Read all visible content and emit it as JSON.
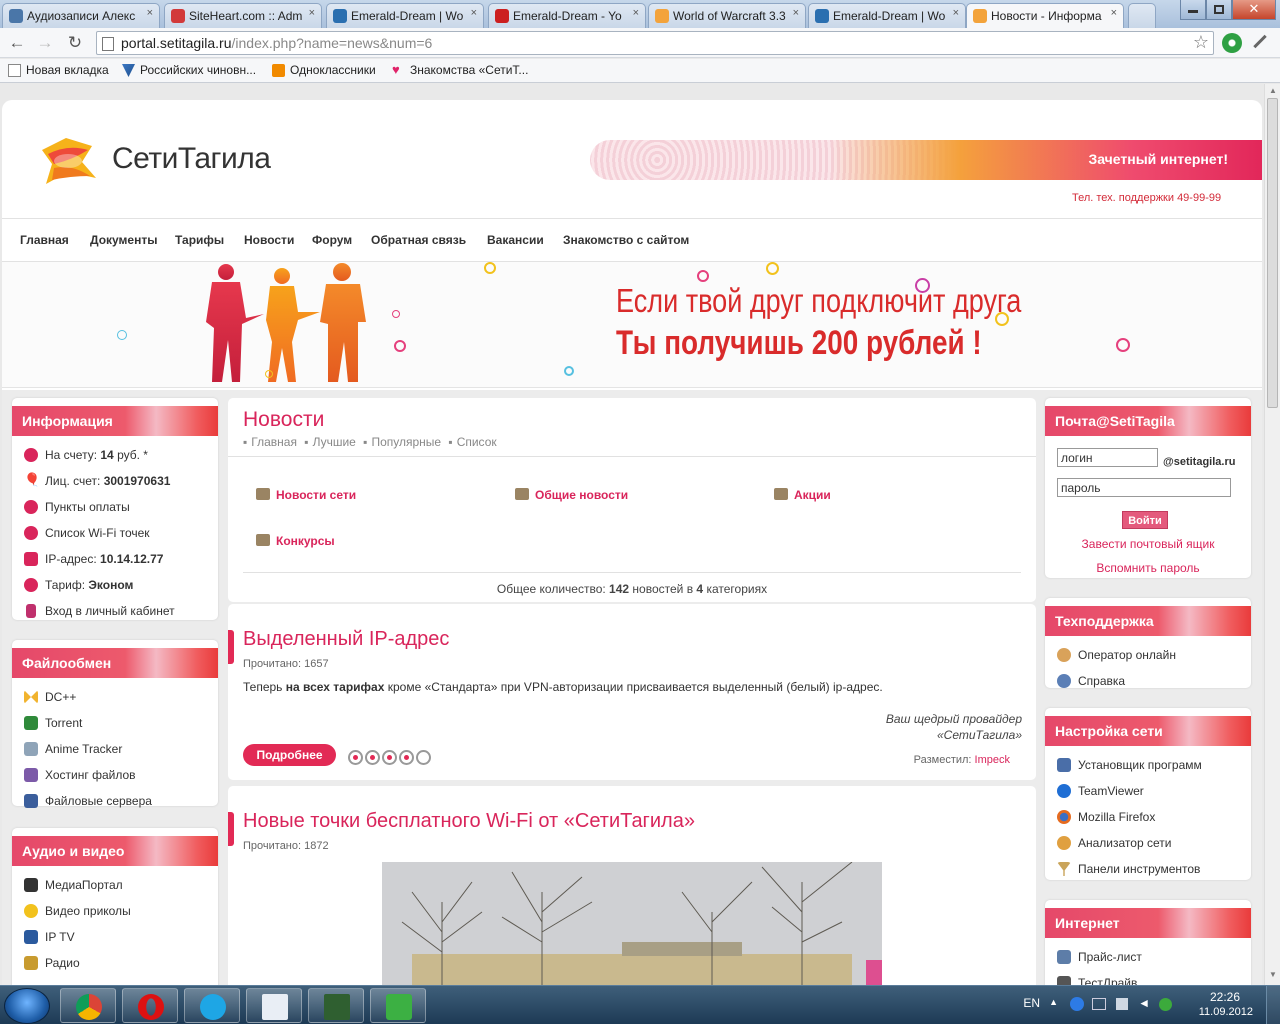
{
  "browser": {
    "tabs": [
      {
        "title": "Аудиозаписи Алекс",
        "color": "#4a76a8"
      },
      {
        "title": "SiteHeart.com :: Adm",
        "color": "#d23a3a"
      },
      {
        "title": "Emerald-Dream | Wo",
        "color": "#2a6fb0"
      },
      {
        "title": "Emerald-Dream - Yo",
        "color": "#cc1f1f"
      },
      {
        "title": "World of Warcraft 3.3",
        "color": "#f3a33b"
      },
      {
        "title": "Emerald-Dream | Wo",
        "color": "#2a6fb0"
      },
      {
        "title": "Новости - Информа",
        "color": "#f3a33b"
      }
    ],
    "tab_close": "×",
    "url_host": "portal.setitagila.ru",
    "url_path": "/index.php?name=news&num=6",
    "bookmarks": [
      "Новая вкладка",
      "Российских чиновн...",
      "Одноклассники",
      "Знакомства «СетиТ..."
    ]
  },
  "site": {
    "logo_text": "СетиТагила",
    "banner_text": "Зачетный интернет!",
    "support_phone": "Тел. тех. поддержки 49-99-99",
    "menu": [
      "Главная",
      "Документы",
      "Тарифы",
      "Новости",
      "Форум",
      "Обратная связь",
      "Вакансии",
      "Знакомство с сайтом"
    ],
    "promo_line1": "Если твой друг подключит друга",
    "promo_line2": "Ты получишь 200 рублей !"
  },
  "left": {
    "info_title": "Информация",
    "info_items": [
      {
        "pre": "На счету: ",
        "bold": "14",
        "post": " руб. *",
        "icon": "coin-icon"
      },
      {
        "pre": "Лиц. счет: ",
        "bold": "3001970631",
        "post": "",
        "icon": "account-icon"
      },
      {
        "pre": "Пункты оплаты",
        "bold": "",
        "post": "",
        "icon": "payment-icon"
      },
      {
        "pre": "Список Wi-Fi точек",
        "bold": "",
        "post": "",
        "icon": "wifi-icon"
      },
      {
        "pre": "IP-адрес: ",
        "bold": "10.14.12.77",
        "post": "",
        "icon": "ip-icon"
      },
      {
        "pre": "Тариф: ",
        "bold": "Эконом",
        "post": "",
        "icon": "tariff-icon"
      },
      {
        "pre": "Вход в личный кабинет",
        "bold": "",
        "post": "",
        "icon": "login-icon"
      }
    ],
    "files_title": "Файлообмен",
    "files_items": [
      "DC++",
      "Torrent",
      "Anime Tracker",
      "Хостинг файлов",
      "Файловые сервера"
    ],
    "media_title": "Аудио и видео",
    "media_items": [
      "МедиаПортал",
      "Видео приколы",
      "IP TV",
      "Радио"
    ]
  },
  "center": {
    "title": "Новости",
    "crumbs": [
      "Главная",
      "Лучшие",
      "Популярные",
      "Список"
    ],
    "categories": [
      "Новости сети",
      "Общие новости",
      "Акции",
      "Конкурсы"
    ],
    "total_pre": "Общее количество: ",
    "total_count": "142",
    "total_mid": " новостей в ",
    "total_cats": "4",
    "total_post": " категориях",
    "article1": {
      "title": "Выделенный IP-адрес",
      "views": "Прочитано: 1657",
      "text_pre": "Теперь ",
      "text_bold": "на всех тарифах",
      "text_post": " кроме «Стандарта» при VPN-авторизации присваивается выделенный (белый) ip-адрес.",
      "sig1": "Ваш щедрый провайдер",
      "sig2": "«СетиТагила»",
      "more": "Подробнее",
      "rating": 4,
      "rating_max": 5,
      "posted_label": "Разместил: ",
      "posted_by": "Impeck"
    },
    "article2": {
      "title": "Новые точки бесплатного Wi-Fi от «СетиТагила»",
      "views": "Прочитано: 1872"
    }
  },
  "right": {
    "mail_title": "Почта@SetiTagila",
    "login_value": "логин",
    "domain": "@setitagila.ru",
    "password_value": "пароль",
    "login_btn": "Войти",
    "create_link": "Завести почтовый ящик",
    "remind_link": "Вспомнить пароль",
    "support_title": "Техподдержка",
    "support_items": [
      "Оператор онлайн",
      "Справка"
    ],
    "net_title": "Настройка сети",
    "net_items": [
      "Установщик программ",
      "TeamViewer",
      "Mozilla Firefox",
      "Анализатор сети",
      "Панели инструментов"
    ],
    "inet_title": "Интернет",
    "inet_items": [
      "Прайс-лист",
      "ТестДрайв"
    ]
  },
  "taskbar": {
    "lang": "EN",
    "time": "22:26",
    "date": "11.09.2012"
  }
}
